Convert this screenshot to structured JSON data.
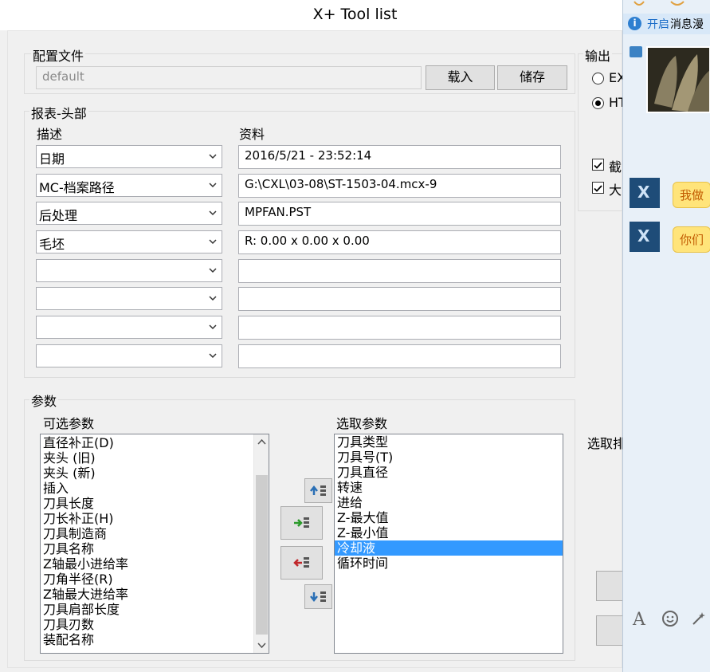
{
  "window": {
    "title": "X+ Tool list"
  },
  "config": {
    "group_label": "配置文件",
    "file_value": "default",
    "load_button": "载入",
    "save_button": "储存"
  },
  "output": {
    "group_label": "输出",
    "radio_excel": "EX",
    "radio_html": "HT",
    "check_1": "截",
    "check_2": "大"
  },
  "header": {
    "group_label": "报表-头部",
    "col_desc": "描述",
    "col_data": "资料",
    "rows": [
      {
        "desc": "日期",
        "data": "2016/5/21 - 23:52:14"
      },
      {
        "desc": "MC-档案路径",
        "data": "G:\\CXL\\03-08\\ST-1503-04.mcx-9"
      },
      {
        "desc": "后处理",
        "data": "MPFAN.PST"
      },
      {
        "desc": "毛坯",
        "data": "R: 0.00 x 0.00 x 0.00"
      },
      {
        "desc": "",
        "data": ""
      },
      {
        "desc": "",
        "data": ""
      },
      {
        "desc": "",
        "data": ""
      },
      {
        "desc": "",
        "data": ""
      }
    ]
  },
  "params": {
    "group_label": "参数",
    "available_label": "可选参数",
    "selected_label": "选取参数",
    "right_label": "选取排",
    "available": [
      "直径补正(D)",
      "夹头 (旧)",
      "夹头 (新)",
      "插入",
      "刀具长度",
      "刀长补正(H)",
      "刀具制造商",
      "刀具名称",
      "Z轴最小进给率",
      "刀角半径(R)",
      "Z轴最大进给率",
      "刀具肩部长度",
      "刀具刃数",
      "装配名称"
    ],
    "selected": [
      "刀具类型",
      "刀具号(T)",
      "刀具直径",
      "转速",
      "进给",
      "Z-最大值",
      "Z-最小值",
      "冷却液",
      "循环时间"
    ],
    "selected_highlight": "冷却液"
  },
  "chat": {
    "banner_link": "开启",
    "banner_text": "消息漫",
    "msg_1": "我做",
    "msg_2": "你们"
  },
  "colors": {
    "selection": "#3399ff",
    "dialog_bg": "#f0f0f0",
    "bubble": "#ffe47a"
  }
}
